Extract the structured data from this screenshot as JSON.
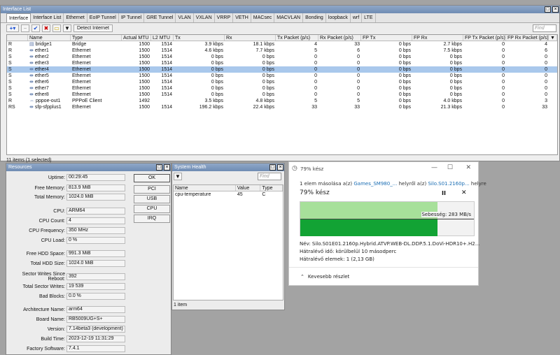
{
  "iflist": {
    "title": "Interface List",
    "tabs": [
      "Interface",
      "Interface List",
      "Ethernet",
      "EoIP Tunnel",
      "IP Tunnel",
      "GRE Tunnel",
      "VLAN",
      "VXLAN",
      "VRRP",
      "VETH",
      "MACsec",
      "MACVLAN",
      "Bonding",
      "loopback",
      "wrf",
      "LTE"
    ],
    "detect_label": "Detect Internet",
    "find_placeholder": "Find",
    "columns": [
      "",
      "Name",
      "Type",
      "Actual MTU",
      "L2 MTU",
      "Tx",
      "Rx",
      "Tx Packet (p/s)",
      "Rx Packet (p/s)",
      "FP Tx",
      "FP Rx",
      "FP Tx Packet (p/s)",
      "FP Rx Packet (p/s)"
    ],
    "rows": [
      {
        "flag": "R",
        "name": "bridge1",
        "type": "Bridge",
        "mtu": "1500",
        "l2": "1514",
        "tx": "3.9 kbps",
        "rx": "18.1 kbps",
        "txp": "4",
        "rxp": "33",
        "fptx": "0 bps",
        "fprx": "2.7 kbps",
        "fptxp": "0",
        "fprxp": "4"
      },
      {
        "flag": "R",
        "name": "ether1",
        "type": "Ethernet",
        "mtu": "1500",
        "l2": "1514",
        "tx": "4.6 kbps",
        "rx": "7.7 kbps",
        "txp": "5",
        "rxp": "6",
        "fptx": "0 bps",
        "fprx": "7.5 kbps",
        "fptxp": "0",
        "fprxp": "6"
      },
      {
        "flag": "S",
        "name": "ether2",
        "type": "Ethernet",
        "mtu": "1500",
        "l2": "1514",
        "tx": "0 bps",
        "rx": "0 bps",
        "txp": "0",
        "rxp": "0",
        "fptx": "0 bps",
        "fprx": "0 bps",
        "fptxp": "0",
        "fprxp": "0"
      },
      {
        "flag": "S",
        "name": "ether3",
        "type": "Ethernet",
        "mtu": "1500",
        "l2": "1514",
        "tx": "0 bps",
        "rx": "0 bps",
        "txp": "0",
        "rxp": "0",
        "fptx": "0 bps",
        "fprx": "0 bps",
        "fptxp": "0",
        "fprxp": "0"
      },
      {
        "flag": "S",
        "name": "ether4",
        "type": "Ethernet",
        "mtu": "1500",
        "l2": "1514",
        "tx": "0 bps",
        "rx": "0 bps",
        "txp": "0",
        "rxp": "0",
        "fptx": "0 bps",
        "fprx": "0 bps",
        "fptxp": "0",
        "fprxp": "0"
      },
      {
        "flag": "S",
        "name": "ether5",
        "type": "Ethernet",
        "mtu": "1500",
        "l2": "1514",
        "tx": "0 bps",
        "rx": "0 bps",
        "txp": "0",
        "rxp": "0",
        "fptx": "0 bps",
        "fprx": "0 bps",
        "fptxp": "0",
        "fprxp": "0"
      },
      {
        "flag": "S",
        "name": "ether6",
        "type": "Ethernet",
        "mtu": "1500",
        "l2": "1514",
        "tx": "0 bps",
        "rx": "0 bps",
        "txp": "0",
        "rxp": "0",
        "fptx": "0 bps",
        "fprx": "0 bps",
        "fptxp": "0",
        "fprxp": "0"
      },
      {
        "flag": "S",
        "name": "ether7",
        "type": "Ethernet",
        "mtu": "1500",
        "l2": "1514",
        "tx": "0 bps",
        "rx": "0 bps",
        "txp": "0",
        "rxp": "0",
        "fptx": "0 bps",
        "fprx": "0 bps",
        "fptxp": "0",
        "fprxp": "0"
      },
      {
        "flag": "S",
        "name": "ether8",
        "type": "Ethernet",
        "mtu": "1500",
        "l2": "1514",
        "tx": "0 bps",
        "rx": "0 bps",
        "txp": "0",
        "rxp": "0",
        "fptx": "0 bps",
        "fprx": "0 bps",
        "fptxp": "0",
        "fprxp": "0"
      },
      {
        "flag": "R",
        "name": "pppoe-out1",
        "type": "PPPoE Client",
        "mtu": "1492",
        "l2": "",
        "tx": "3.5 kbps",
        "rx": "4.8 kbps",
        "txp": "5",
        "rxp": "5",
        "fptx": "0 bps",
        "fprx": "4.0 kbps",
        "fptxp": "0",
        "fprxp": "3"
      },
      {
        "flag": "RS",
        "name": "sfp-sfpplus1",
        "type": "Ethernet",
        "mtu": "1500",
        "l2": "1514",
        "tx": "196.2 kbps",
        "rx": "22.4 kbps",
        "txp": "33",
        "rxp": "33",
        "fptx": "0 bps",
        "fprx": "21.3 kbps",
        "fptxp": "0",
        "fprxp": "33"
      }
    ],
    "selected_row": 4,
    "status": "11 items (1 selected)"
  },
  "resources": {
    "title": "Resources",
    "fields": [
      {
        "label": "Uptime:",
        "value": "00:29:45"
      },
      {
        "label": "Free Memory:",
        "value": "813.9 MiB"
      },
      {
        "label": "Total Memory:",
        "value": "1024.0 MiB"
      },
      {
        "label": "CPU:",
        "value": "ARM64"
      },
      {
        "label": "CPU Count:",
        "value": "4"
      },
      {
        "label": "CPU Frequency:",
        "value": "350 MHz"
      },
      {
        "label": "CPU Load:",
        "value": "0 %"
      },
      {
        "label": "Free HDD Space:",
        "value": "991.3 MiB"
      },
      {
        "label": "Total HDD Size:",
        "value": "1024.0 MiB"
      },
      {
        "label": "Sector Writes Since Reboot:",
        "value": "392"
      },
      {
        "label": "Total Sector Writes:",
        "value": "19 539"
      },
      {
        "label": "Bad Blocks:",
        "value": "0.0 %"
      },
      {
        "label": "Architecture Name:",
        "value": "arm64"
      },
      {
        "label": "Board Name:",
        "value": "RB5009UG+S+"
      },
      {
        "label": "Version:",
        "value": "7.14beta3 (development)"
      },
      {
        "label": "Build Time:",
        "value": "2023-12-19 11:31:29"
      },
      {
        "label": "Factory Software:",
        "value": "7.4.1"
      }
    ],
    "buttons": [
      "OK",
      "PCI",
      "USB",
      "CPU",
      "IRQ"
    ]
  },
  "health": {
    "title": "System Health",
    "find_placeholder": "Find",
    "columns": [
      "Name",
      "Value",
      "Type"
    ],
    "rows": [
      {
        "name": "cpu-temperature",
        "value": "45",
        "type": "C"
      }
    ],
    "status": "1 item"
  },
  "copy": {
    "title": "79% kész",
    "line1_pre": "1 elem másolása a(z) ",
    "line1_src": "Games_SM980_...",
    "line1_mid": " helyről a(z) ",
    "line1_dst": "Silo.S01.2160p...",
    "line1_post": " helyre",
    "progress_text": "79% kész",
    "progress": 0.79,
    "speed": "Sebesség: 283 MB/s",
    "name": "Név:  Silo.S01E01.2160p.Hybrid.ATVP.WEB-DL.DDP.5.1.DoVi-HDR10+.H2...",
    "time_left": "Hátralévő idő:  körülbelül 10 másodperc",
    "items_left": "Hátralévő elemek:  1 (2,13 GB)",
    "less_details": "Kevesebb részlet",
    "accent": "#12a334"
  }
}
